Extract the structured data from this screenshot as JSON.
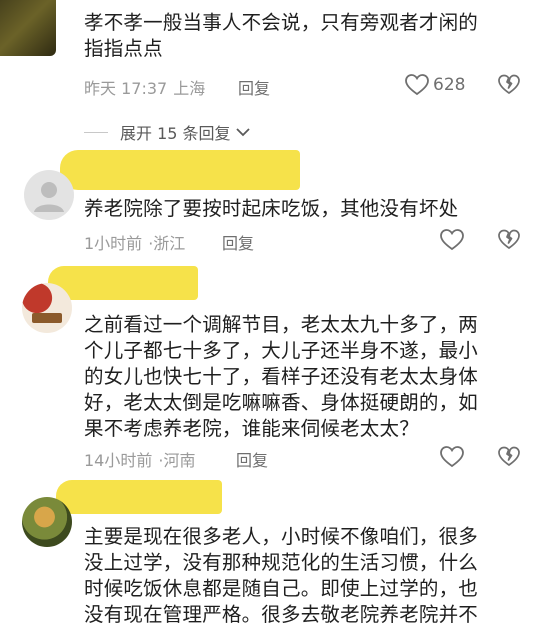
{
  "comments": [
    {
      "lines": [
        "孝不孝一般当事人不会说，只有旁观者才闲的",
        "指指点点"
      ],
      "time": "昨天 17:37",
      "location": "上海",
      "reply_label": "回复",
      "likes": "628"
    },
    {
      "lines": [
        "养老院除了要按时起床吃饭，其他没有坏处"
      ],
      "time": "1小时前",
      "location": "浙江",
      "reply_label": "回复"
    },
    {
      "lines": [
        "之前看过一个调解节目，老太太九十多了，两",
        "个儿子都七十多了，大儿子还半身不遂，最小",
        "的女儿也快七十了，看样子还没有老太太身体",
        "好，老太太倒是吃嘛嘛香、身体挺硬朗的，如",
        "果不考虑养老院，谁能来伺候老太太？"
      ],
      "time": "14小时前",
      "location": "河南",
      "reply_label": "回复"
    },
    {
      "lines": [
        "主要是现在很多老人，小时候不像咱们，很多",
        "没上过学，没有那种规范化的生活习惯，什么",
        "时候吃饭休息都是随自己。即使上过学的，也",
        "没有现在管理严格。很多去敬老院养老院并不"
      ]
    }
  ],
  "expand": {
    "label": "展开 15 条回复"
  },
  "colors": {
    "redact_yellow": "#f6e24a",
    "meta_gray": "#9a9a9a"
  },
  "icons": [
    "heart-outline-icon",
    "broken-heart-icon",
    "chevron-down-icon"
  ]
}
